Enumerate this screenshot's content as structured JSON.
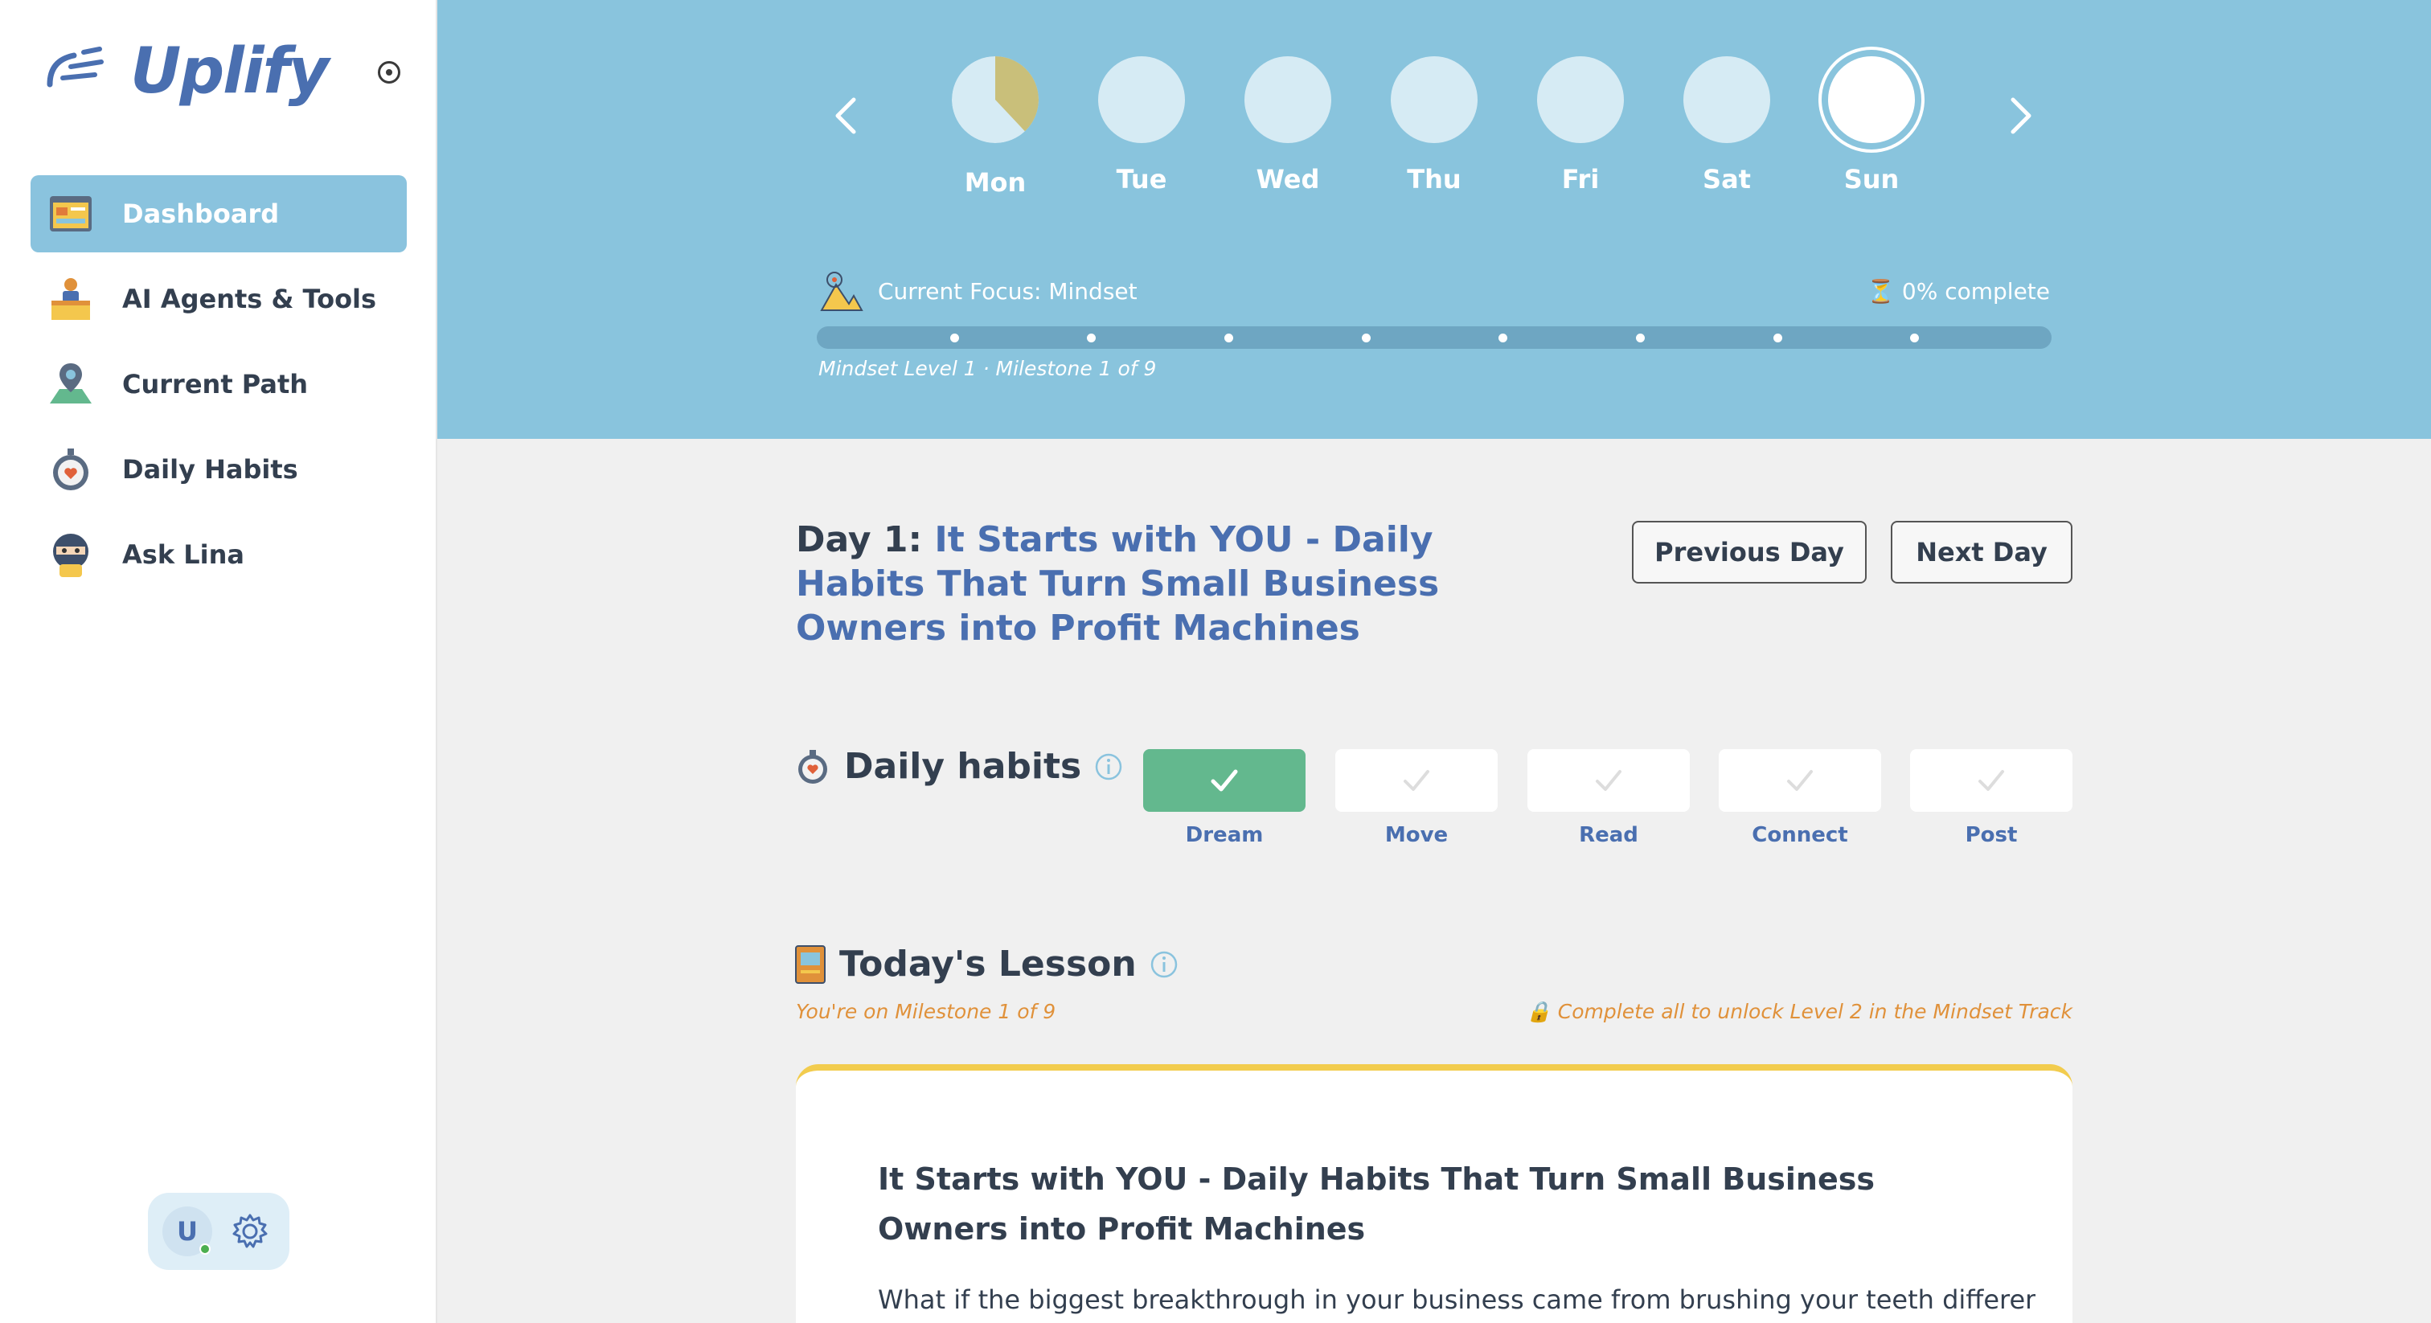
{
  "brand": {
    "name": "Uplify"
  },
  "sidebar": {
    "items": [
      {
        "label": "Dashboard",
        "icon": "dashboard-window-icon",
        "active": true
      },
      {
        "label": "AI Agents & Tools",
        "icon": "agent-box-icon"
      },
      {
        "label": "Current Path",
        "icon": "map-pin-icon"
      },
      {
        "label": "Daily Habits",
        "icon": "stopwatch-heart-icon"
      },
      {
        "label": "Ask Lina",
        "icon": "ninja-avatar-icon"
      }
    ]
  },
  "user": {
    "initial": "U",
    "status": "online"
  },
  "week": {
    "days": [
      {
        "label": "Mon",
        "progress": 0.38
      },
      {
        "label": "Tue",
        "progress": 0
      },
      {
        "label": "Wed",
        "progress": 0
      },
      {
        "label": "Thu",
        "progress": 0
      },
      {
        "label": "Fri",
        "progress": 0
      },
      {
        "label": "Sat",
        "progress": 0
      },
      {
        "label": "Sun",
        "progress": 0,
        "selected": true
      }
    ]
  },
  "focus": {
    "label": "Current Focus: Mindset",
    "complete": "0% complete",
    "progress_percent": 0,
    "milestones_total": 9,
    "subtitle": "Mindset Level 1 · Milestone 1 of 9"
  },
  "day": {
    "prefix": "Day 1:",
    "title": "It Starts with YOU - Daily Habits That Turn Small Business Owners into Profit Machines",
    "prev_label": "Previous Day",
    "next_label": "Next Day"
  },
  "habits": {
    "title": "Daily habits",
    "items": [
      {
        "label": "Dream",
        "done": true
      },
      {
        "label": "Move",
        "done": false
      },
      {
        "label": "Read",
        "done": false
      },
      {
        "label": "Connect",
        "done": false
      },
      {
        "label": "Post",
        "done": false
      }
    ]
  },
  "lesson": {
    "title": "Today's Lesson",
    "milestone_note": "You're on Milestone 1 of 9",
    "unlock_note": "🔒 Complete all to unlock Level 2 in the Mindset Track",
    "card_title": "It Starts with YOU - Daily Habits That Turn Small Business Owners into Profit Machines",
    "card_body": "What if the biggest breakthrough in your business came from brushing your teeth differently,"
  },
  "colors": {
    "accent": "#4a6fb0",
    "banner": "#89c4dd",
    "done": "#63b88e",
    "highlight": "#f2cc4e",
    "note": "#e0913a"
  }
}
